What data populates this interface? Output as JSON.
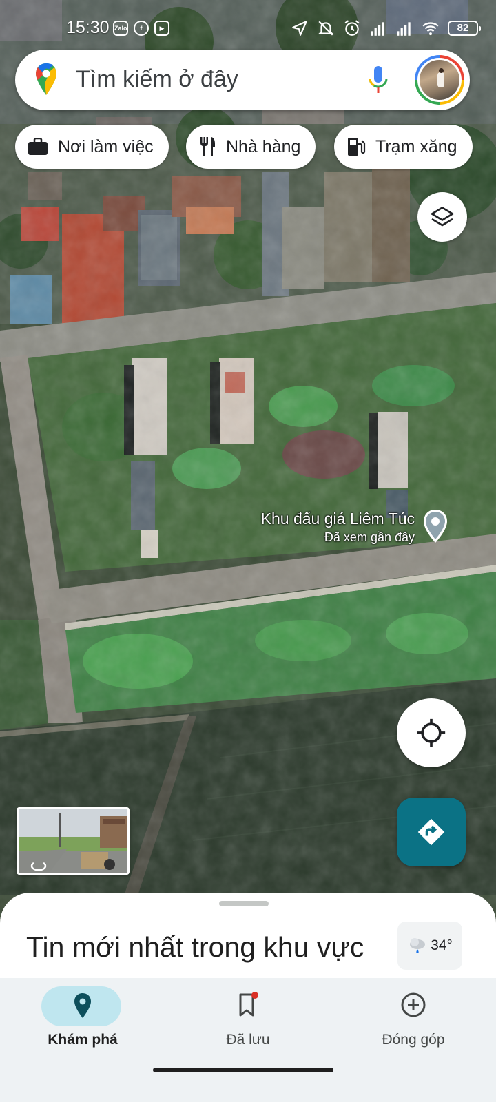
{
  "status_bar": {
    "time": "15:30",
    "apps": [
      "Zalo",
      "f",
      "▶"
    ],
    "battery": "82"
  },
  "search": {
    "placeholder": "Tìm kiếm ở đây"
  },
  "chips": [
    {
      "label": "Nơi làm việc",
      "icon": "briefcase-icon"
    },
    {
      "label": "Nhà hàng",
      "icon": "fork-knife-icon"
    },
    {
      "label": "Trạm xăng",
      "icon": "gas-station-icon"
    }
  ],
  "map": {
    "place_name": "Khu đấu giá Liêm Túc",
    "place_sub": "Đã xem gần đây"
  },
  "sheet": {
    "title": "Tin mới nhất trong khu vực",
    "weather": "34°"
  },
  "nav": {
    "items": [
      {
        "label": "Khám phá",
        "icon": "explore-pin-icon",
        "active": true
      },
      {
        "label": "Đã lưu",
        "icon": "bookmark-icon",
        "active": false
      },
      {
        "label": "Đóng góp",
        "icon": "add-circle-icon",
        "active": false
      }
    ]
  },
  "colors": {
    "accent": "#0b7285",
    "nav_active_pill": "#bfe6ef",
    "nav_bg": "#eef2f4"
  }
}
